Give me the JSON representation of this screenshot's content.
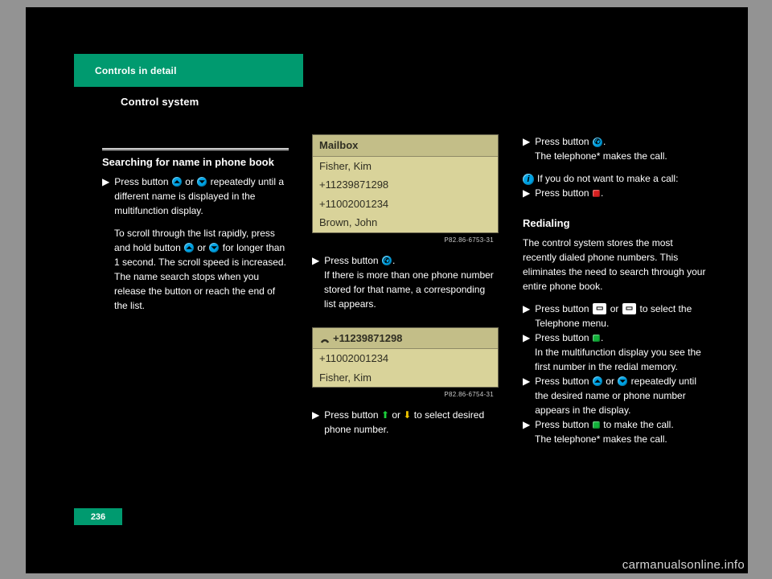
{
  "header": {
    "tab": "Controls in detail",
    "subtitle": "Control system"
  },
  "col1": {
    "head": "Searching for name in phone book",
    "step1_a": "Press button ",
    "step1_b": " or ",
    "step1_c": " repeatedly until a different name is displayed in the multifunction display.",
    "hold_a": "To scroll through the list rapidly, press and hold button ",
    "hold_b": " or ",
    "hold_c": " for longer than 1 second. The scroll speed is increased. The name search stops when you release the button or reach the end of the list."
  },
  "col2": {
    "screen1": {
      "title": "Mailbox",
      "rows": [
        "Fisher, Kim",
        "+11239871298",
        "+11002001234",
        "Brown, John"
      ],
      "code": "P82.86-6753-31"
    },
    "step_sel_a": "Press button ",
    "step_sel_b": ".",
    "name_more": "If there is more than one phone number stored for that name, a corresponding list appears.",
    "screen2": {
      "title_num": "+11239871298",
      "rows": [
        "+11002001234",
        "Fisher, Kim"
      ],
      "code": "P82.86-6754-31"
    },
    "step2_a": "Press button ",
    "step2_b": " or ",
    "step2_c": " to select desired phone number."
  },
  "col3": {
    "step_call_a": "Press button ",
    "step_call_b": ".",
    "call_made": "The telephone* makes the call.",
    "info_lead": "If you do not want to make a call:",
    "step_close_a": "Press button ",
    "step_close_b": ".",
    "redial_head": "Redialing",
    "redial_body": "The control system stores the most recently dialed phone numbers. This eliminates the need to search through your entire phone book.",
    "step_r1_a": "Press button ",
    "step_r1_b": " or ",
    "step_r1_c": " to select the Telephone menu.",
    "step_r2_a": "Press button ",
    "step_r2_b": ".",
    "r2_result": "In the multifunction display you see the first number in the redial memory.",
    "step_r3_a": "Press button ",
    "step_r3_b": " or ",
    "step_r3_c": " repeatedly until the desired name or phone number appears in the display.",
    "step_r4_a": "Press button ",
    "step_r4_b": " to make the call.",
    "r4_result": "The telephone* makes the call."
  },
  "page_number": "236",
  "watermark": "carmanualsonline.info"
}
